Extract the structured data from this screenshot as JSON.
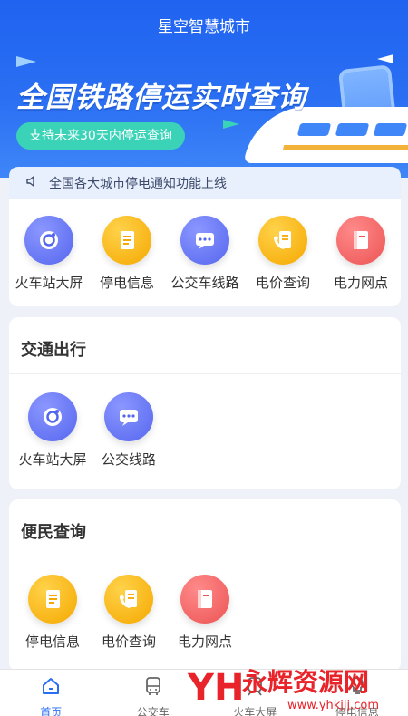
{
  "app": {
    "title": "星空智慧城市"
  },
  "banner": {
    "title": "全国铁路停运实时查询",
    "subtitle": "支持未来30天内停运查询"
  },
  "notice": {
    "text": "全国各大城市停电通知功能上线"
  },
  "quick_links": [
    {
      "label": "火车站大屏",
      "icon": "camera-icon",
      "color": "#6677f2"
    },
    {
      "label": "停电信息",
      "icon": "document-icon",
      "color": "#f5b516"
    },
    {
      "label": "公交车线路",
      "icon": "chat-icon",
      "color": "#6677f2"
    },
    {
      "label": "电价查询",
      "icon": "phone-doc-icon",
      "color": "#f5b516"
    },
    {
      "label": "电力网点",
      "icon": "book-icon",
      "color": "#f26b6b"
    }
  ],
  "traffic": {
    "title": "交通出行",
    "items": [
      {
        "label": "火车站大屏",
        "icon": "camera-icon"
      },
      {
        "label": "公交线路",
        "icon": "chat-icon"
      }
    ]
  },
  "convenience": {
    "title": "便民查询",
    "items": [
      {
        "label": "停电信息",
        "icon": "document-icon"
      },
      {
        "label": "电价查询",
        "icon": "phone-doc-icon"
      },
      {
        "label": "电力网点",
        "icon": "book-icon"
      }
    ]
  },
  "tabbar": [
    {
      "label": "首页",
      "icon": "home-icon",
      "active": true
    },
    {
      "label": "公交车",
      "icon": "bus-icon",
      "active": false
    },
    {
      "label": "火车大屏",
      "icon": "train-icon",
      "active": false
    },
    {
      "label": "停电信息",
      "icon": "bulb-icon",
      "active": false
    }
  ],
  "watermark": {
    "brand": "永辉资源网",
    "url": "www.yhkjjj.com"
  },
  "colors": {
    "primary": "#2a6ff3",
    "accent_green": "#3ad3b8",
    "blue_icon": "#6677f2",
    "yellow_icon": "#f5b516",
    "red_icon": "#f26b6b"
  }
}
